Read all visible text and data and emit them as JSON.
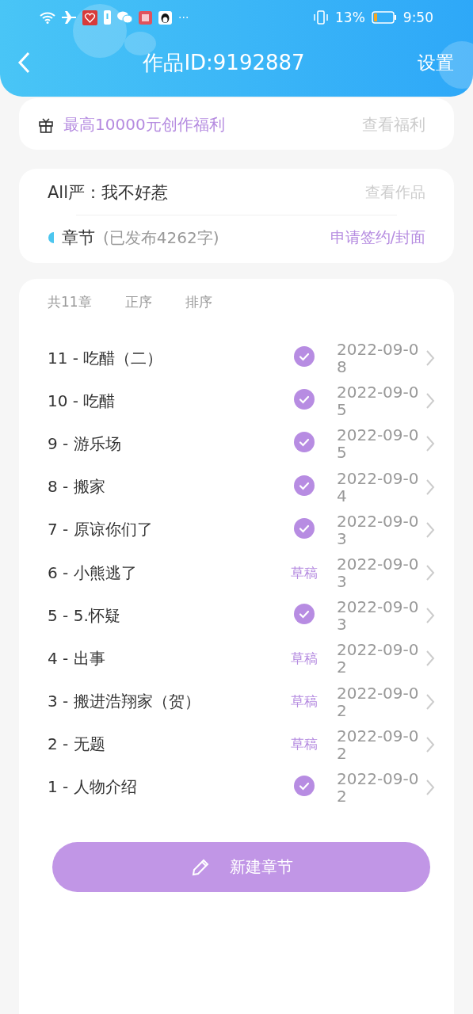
{
  "status_bar": {
    "battery_percent": "13%",
    "time": "9:50",
    "more": "···"
  },
  "header": {
    "title": "作品ID:9192887",
    "action": "设置"
  },
  "promo": {
    "text": "最高10000元创作福利",
    "link": "查看福利"
  },
  "work": {
    "name": "All严：我不好惹",
    "link": "查看作品",
    "section": "章节",
    "section_note": "(已发布4262字)",
    "action": "申请签约/封面"
  },
  "chapters": {
    "count": "共11章",
    "order": "正序",
    "sort": "排序",
    "rows": [
      {
        "title": "11 - 吃醋（二）",
        "kind": "published",
        "date": "2022-09-08"
      },
      {
        "title": "10 - 吃醋",
        "kind": "published",
        "date": "2022-09-05"
      },
      {
        "title": "9 - 游乐场",
        "kind": "published",
        "date": "2022-09-05"
      },
      {
        "title": "8 - 搬家",
        "kind": "published",
        "date": "2022-09-04"
      },
      {
        "title": "7 - 原谅你们了",
        "kind": "published",
        "date": "2022-09-03"
      },
      {
        "title": "6 - 小熊逃了",
        "kind": "draft",
        "label": "草稿",
        "date": "2022-09-03"
      },
      {
        "title": "5 - 5.怀疑",
        "kind": "published",
        "date": "2022-09-03"
      },
      {
        "title": "4 - 出事",
        "kind": "draft",
        "label": "草稿",
        "date": "2022-09-02"
      },
      {
        "title": "3 - 搬进浩翔家（贺）",
        "kind": "draft",
        "label": "草稿",
        "date": "2022-09-02"
      },
      {
        "title": "2 - 无题",
        "kind": "draft",
        "label": "草稿",
        "date": "2022-09-02"
      },
      {
        "title": "1 - 人物介绍",
        "kind": "published",
        "date": "2022-09-02"
      }
    ]
  },
  "new_button": "新建章节"
}
